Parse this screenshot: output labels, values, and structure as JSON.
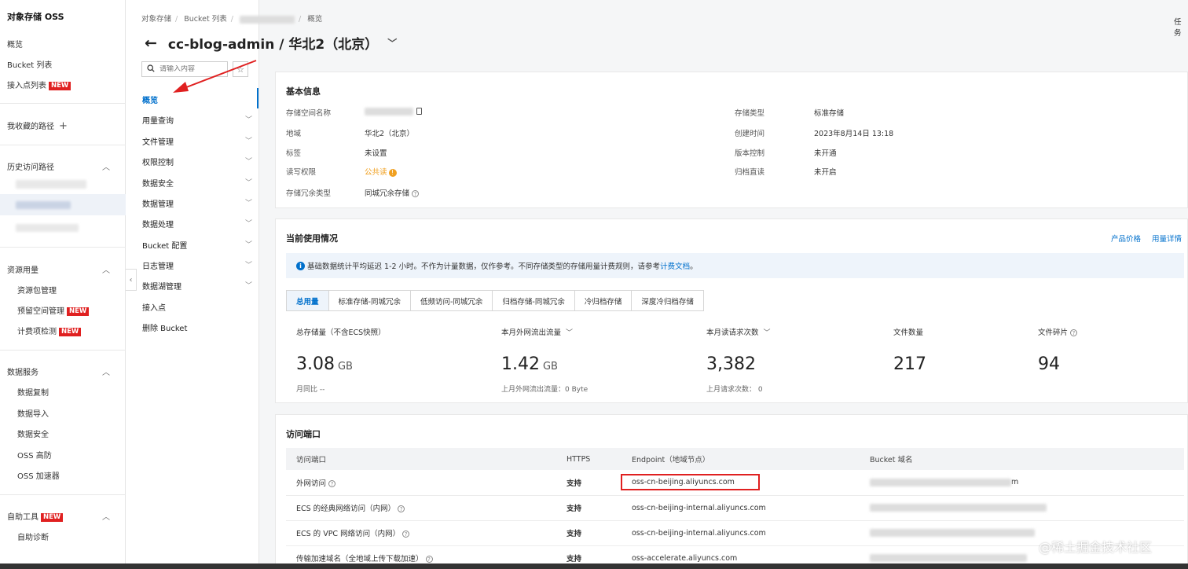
{
  "sidebar": {
    "title": "对象存储 OSS",
    "overview": "概览",
    "bucket_list": "Bucket 列表",
    "access_point_list": "接入点列表",
    "new_badge": "NEW",
    "favorites": "我收藏的路径",
    "history": "历史访问路径",
    "resource_usage": "资源用量",
    "resource_package": "资源包管理",
    "reserved_space": "预留空间管理",
    "billing_check": "计费项检测",
    "data_services": "数据服务",
    "data_replication": "数据复制",
    "data_import": "数据导入",
    "data_security": "数据安全",
    "oss_ddos": "OSS 高防",
    "oss_accelerator": "OSS 加速器",
    "self_tools": "自助工具",
    "self_diagnosis": "自助诊断"
  },
  "header": {
    "breadcrumb": [
      "对象存储",
      "Bucket 列表",
      "概览"
    ],
    "title": "cc-blog-admin / 华北2（北京）",
    "top_right": "任务"
  },
  "subnav": {
    "search_placeholder": "请输入内容",
    "items": [
      {
        "label": "概览"
      },
      {
        "label": "用量查询"
      },
      {
        "label": "文件管理"
      },
      {
        "label": "权限控制"
      },
      {
        "label": "数据安全"
      },
      {
        "label": "数据管理"
      },
      {
        "label": "数据处理"
      },
      {
        "label": "Bucket 配置"
      },
      {
        "label": "日志管理"
      },
      {
        "label": "数据湖管理"
      },
      {
        "label": "接入点"
      },
      {
        "label": "删除 Bucket"
      }
    ]
  },
  "basic": {
    "title": "基本信息",
    "bucket_name_label": "存储空间名称",
    "region_label": "地域",
    "region_value": "华北2（北京）",
    "tags_label": "标签",
    "tags_value": "未设置",
    "acl_label": "读写权限",
    "acl_value": "公共读",
    "redundancy_label": "存储冗余类型",
    "redundancy_value": "同城冗余存储",
    "storage_class_label": "存储类型",
    "storage_class_value": "标准存储",
    "created_label": "创建时间",
    "created_value": "2023年8月14日 13:18",
    "versioning_label": "版本控制",
    "versioning_value": "未开通",
    "archive_label": "归档直读",
    "archive_value": "未开启"
  },
  "usage": {
    "title": "当前使用情况",
    "product_price": "产品价格",
    "usage_detail": "用量详情",
    "notice": "基础数据统计平均延迟 1-2 小时。不作为计量数据，仅作参考。不同存储类型的存储用量计费规则，请参考",
    "notice_link": "计费文档",
    "notice_end": "。",
    "tabs": [
      "总用量",
      "标准存储-同城冗余",
      "低频访问-同城冗余",
      "归档存储-同城冗余",
      "冷归档存储",
      "深度冷归档存储"
    ],
    "metrics": [
      {
        "label": "总存储量（不含ECS快照）",
        "value": "3.08",
        "unit": "GB",
        "sub": "月同比 --"
      },
      {
        "label": "本月外网流出流量",
        "value": "1.42",
        "unit": "GB",
        "sub": "上月外网流出流量：0 Byte"
      },
      {
        "label": "本月读请求次数",
        "value": "3,382",
        "unit": "",
        "sub": "上月请求次数：  0"
      },
      {
        "label": "文件数量",
        "value": "217",
        "unit": "",
        "sub": ""
      },
      {
        "label": "文件碎片",
        "value": "94",
        "unit": "",
        "sub": ""
      }
    ]
  },
  "endpoints": {
    "title": "访问端口",
    "headers": [
      "访问端口",
      "HTTPS",
      "Endpoint（地域节点）",
      "Bucket 域名"
    ],
    "rows": [
      {
        "name": "外网访问",
        "https": "支持",
        "endpoint": "oss-cn-beijing.aliyuncs.com",
        "domain_suffix": "m"
      },
      {
        "name": "ECS 的经典网络访问（内网）",
        "https": "支持",
        "endpoint": "oss-cn-beijing-internal.aliyuncs.com",
        "domain_suffix": ""
      },
      {
        "name": "ECS 的 VPC 网络访问（内网）",
        "https": "支持",
        "endpoint": "oss-cn-beijing-internal.aliyuncs.com",
        "domain_suffix": ""
      },
      {
        "name": "传输加速域名（全地域上传下载加速）",
        "https": "支持",
        "endpoint": "oss-accelerate.aliyuncs.com",
        "domain_suffix": ""
      }
    ]
  },
  "watermark": "@稀土掘金技术社区",
  "colors": {
    "accent": "#0070cc",
    "new_badge": "#e02020",
    "support": "#1a9a3a",
    "warning": "#f0a020"
  }
}
